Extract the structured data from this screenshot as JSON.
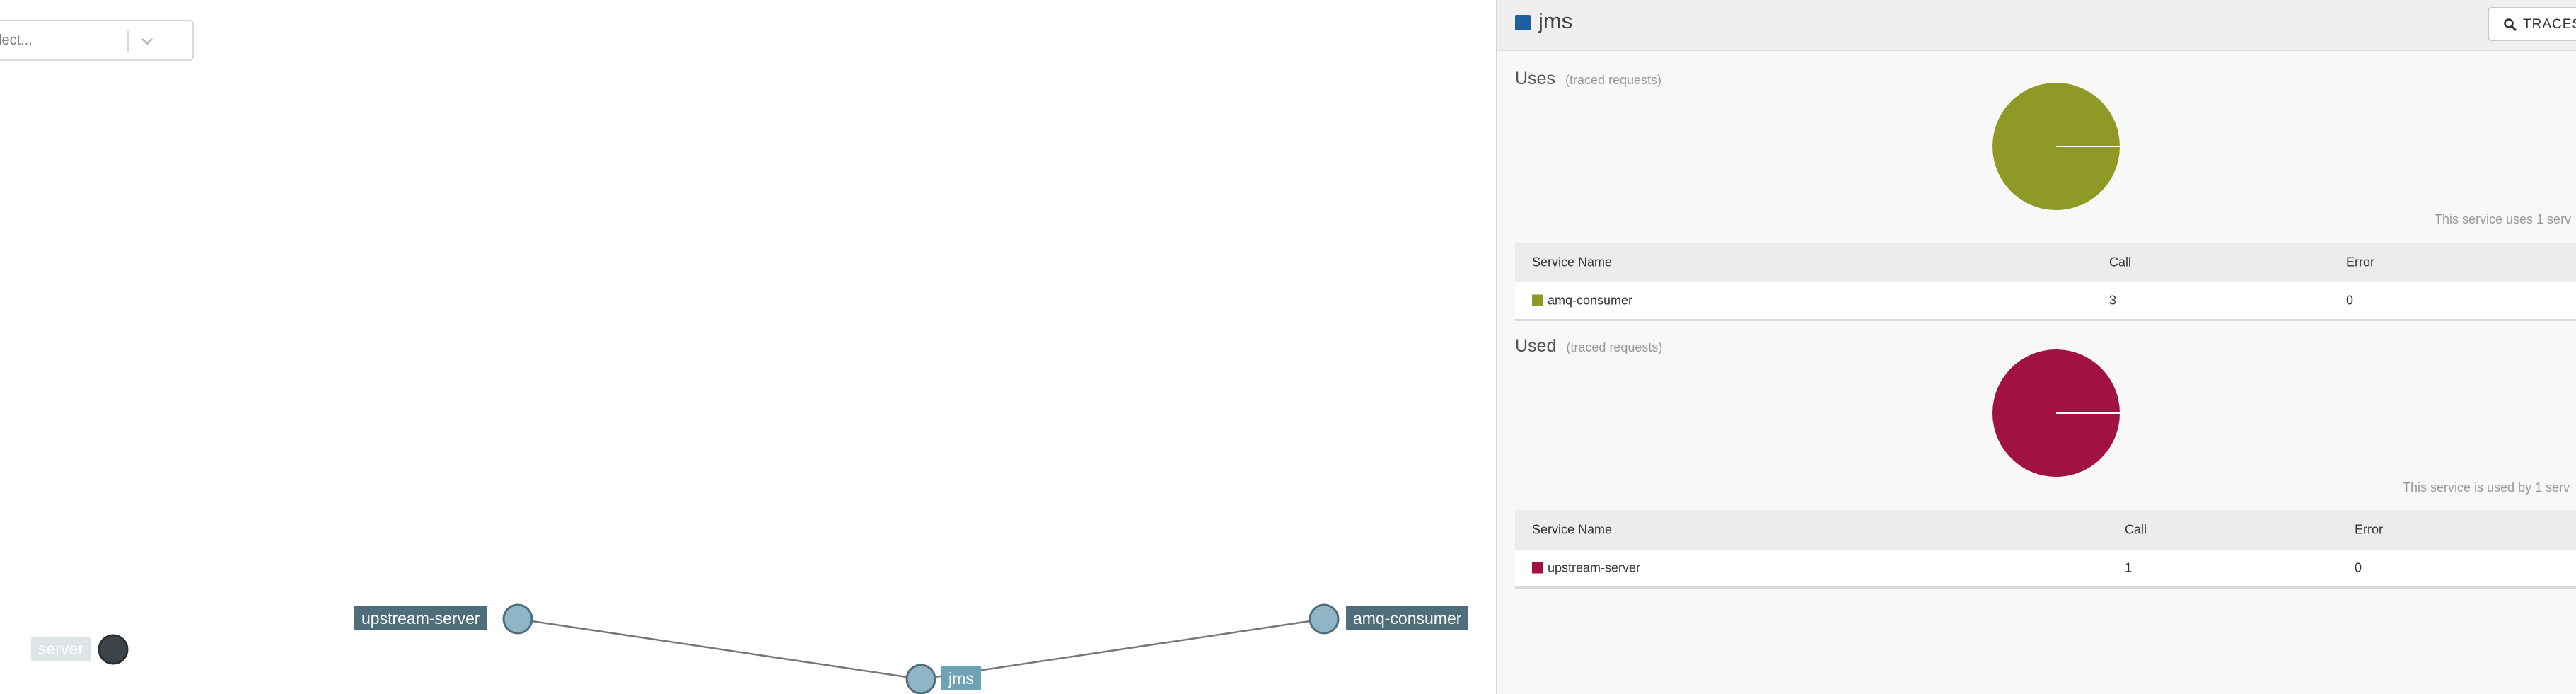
{
  "graph": {
    "filter_placeholder": "lect...",
    "nodes": [
      {
        "label": "server"
      },
      {
        "label": "upstream-server"
      },
      {
        "label": "jms"
      },
      {
        "label": "amq-consumer"
      }
    ]
  },
  "panel": {
    "service_name": "jms",
    "traces_button": "TRACES",
    "uses": {
      "title": "Uses",
      "subtitle": "(traced requests)",
      "summary": "This service uses 1 serv",
      "color": "#8f9a26",
      "columns": [
        "Service Name",
        "Call",
        "Error"
      ],
      "rows": [
        {
          "service": "amq-consumer",
          "call": "3",
          "error": "0"
        }
      ]
    },
    "used": {
      "title": "Used",
      "subtitle": "(traced requests)",
      "summary": "This service is used by 1 serv",
      "color": "#a11240",
      "columns": [
        "Service Name",
        "Call",
        "Error"
      ],
      "rows": [
        {
          "service": "upstream-server",
          "call": "1",
          "error": "0"
        }
      ]
    }
  }
}
